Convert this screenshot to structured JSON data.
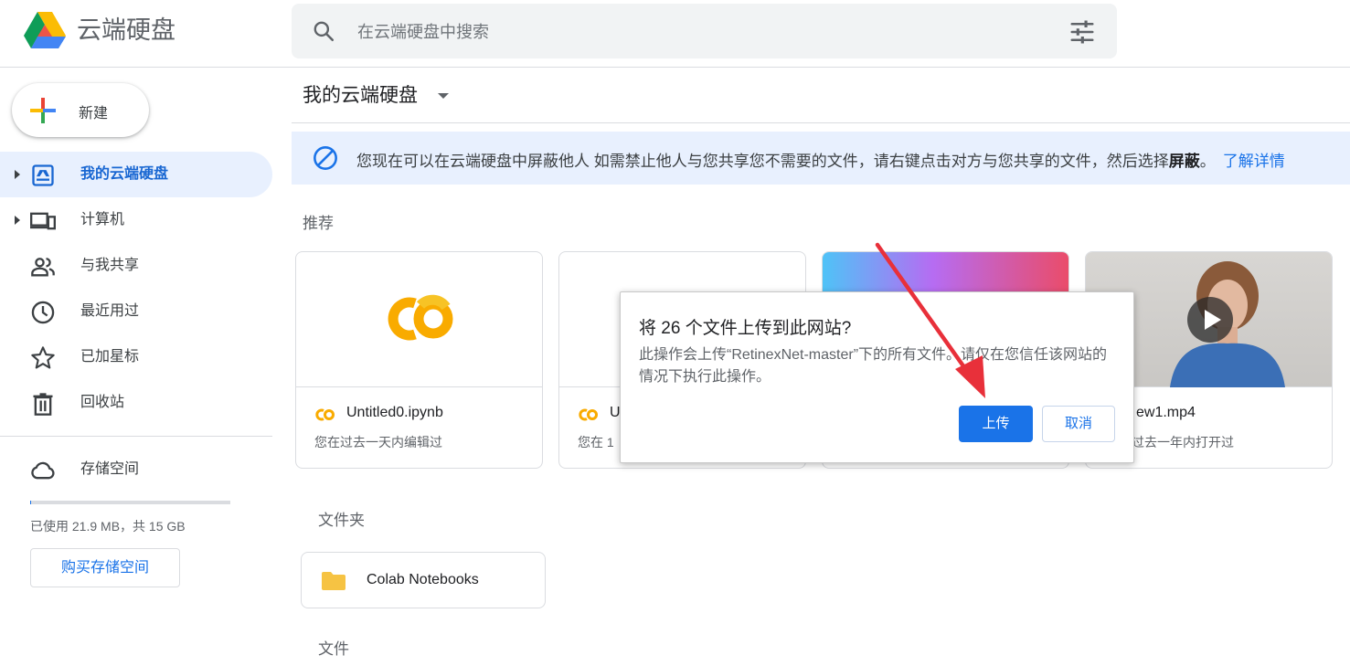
{
  "header": {
    "app_title": "云端硬盘",
    "search_placeholder": "在云端硬盘中搜索",
    "logo_icon": "google-drive-logo",
    "search_icon": "search-icon",
    "filter_icon": "tune-icon"
  },
  "sidebar": {
    "new_label": "新建",
    "items": [
      {
        "label": "我的云端硬盘",
        "icon": "my-drive-icon",
        "active": true,
        "has_caret": true
      },
      {
        "label": "计算机",
        "icon": "computers-icon",
        "active": false,
        "has_caret": true
      },
      {
        "label": "与我共享",
        "icon": "shared-people-icon",
        "active": false,
        "has_caret": false
      },
      {
        "label": "最近用过",
        "icon": "clock-icon",
        "active": false,
        "has_caret": false
      },
      {
        "label": "已加星标",
        "icon": "star-icon",
        "active": false,
        "has_caret": false
      },
      {
        "label": "回收站",
        "icon": "trash-icon",
        "active": false,
        "has_caret": false
      }
    ],
    "storage": {
      "label": "存储空间",
      "usage_text": "已使用 21.9 MB，共 15 GB",
      "used_fraction": 0.0014,
      "buy_label": "购买存储空间"
    }
  },
  "main": {
    "title": "我的云端硬盘",
    "banner": {
      "text_main": "您现在可以在云端硬盘中屏蔽他人 如需禁止他人与您共享您不需要的文件，请右键点击对方与您共享的文件，然后选择",
      "text_bold": "屏蔽",
      "text_end": "。",
      "link": "了解详情"
    },
    "suggested_label": "推荐",
    "cards": [
      {
        "name": "Untitled0.ipynb",
        "meta": "您在过去一天内编辑过",
        "icon": "colab-icon"
      },
      {
        "name": "U",
        "meta": "您在 1",
        "icon": "colab-icon"
      },
      {
        "name": "",
        "meta": "",
        "icon": "gradient-thumbnail"
      },
      {
        "name": "ew1.mp4",
        "meta": "过去一年内打开过",
        "icon": "video-icon"
      }
    ],
    "folders_label": "文件夹",
    "folders": [
      {
        "name": "Colab Notebooks"
      }
    ],
    "files_label": "文件"
  },
  "dialog": {
    "title": "将 26 个文件上传到此网站?",
    "body": "此操作会上传“RetinexNet-master”下的所有文件。请仅在您信任该网站的情况下执行此操作。",
    "upload_label": "上传",
    "cancel_label": "取消"
  },
  "colors": {
    "accent": "#1a73e8",
    "active_bg": "#e8f0fe",
    "annotation_arrow": "#e8303a"
  }
}
